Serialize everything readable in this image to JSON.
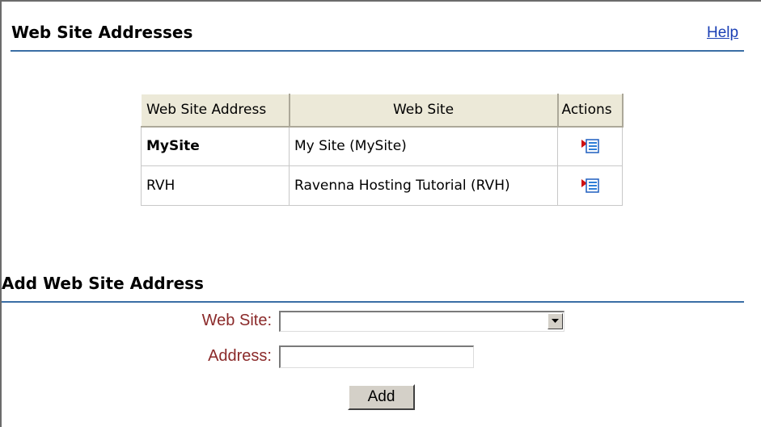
{
  "header": {
    "title": "Web Site Addresses",
    "help_link": "Help"
  },
  "addresses_table": {
    "columns": [
      "Web Site Address",
      "Web Site",
      "Actions"
    ],
    "rows": [
      {
        "address": "MySite",
        "web_site": "My Site (MySite)",
        "bold": true,
        "action_icon": "action-menu-icon"
      },
      {
        "address": "RVH",
        "web_site": "Ravenna Hosting Tutorial (RVH)",
        "bold": false,
        "action_icon": "action-menu-icon"
      }
    ]
  },
  "add_form": {
    "title": "Add Web Site Address",
    "web_site_label": "Web Site:",
    "web_site_value": "",
    "address_label": "Address:",
    "address_value": "",
    "address_placeholder": "",
    "submit_label": "Add"
  },
  "colors": {
    "rule": "#3a6ea5",
    "link": "#1a3fb5",
    "form_label": "#8b2a2a",
    "header_bg": "#ece9d8",
    "button_face": "#d4d0c8"
  }
}
